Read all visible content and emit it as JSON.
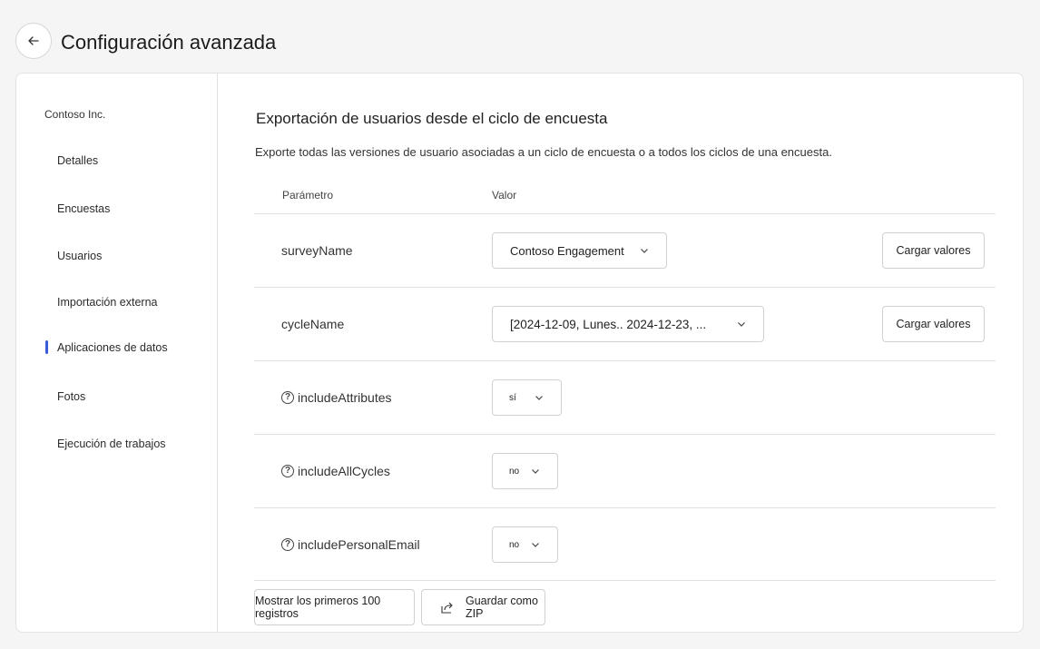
{
  "header": {
    "title": "Configuración avanzada"
  },
  "sidebar": {
    "org": "Contoso Inc.",
    "items": [
      {
        "label": "Detalles"
      },
      {
        "label": "Encuestas"
      },
      {
        "label": "Usuarios"
      },
      {
        "label": "Importación externa"
      },
      {
        "label": "Aplicaciones de datos",
        "active": true
      },
      {
        "label": "Fotos"
      },
      {
        "label": "Ejecución de trabajos"
      }
    ]
  },
  "main": {
    "title": "Exportación de usuarios desde el ciclo de encuesta",
    "description": "Exporte todas las versiones de usuario asociadas a un ciclo de encuesta o a todos los ciclos de una encuesta.",
    "col_param": "Parámetro",
    "col_value": "Valor",
    "rows": [
      {
        "param": "surveyName",
        "value": "Contoso Engagement",
        "button": "Cargar valores"
      },
      {
        "param": "cycleName",
        "value": "[2024-12-09, Lunes.. 2024-12-23, ...",
        "button": "Cargar valores"
      },
      {
        "param": "includeAttributes",
        "value": "sí"
      },
      {
        "param": "includeAllCycles",
        "value": "no"
      },
      {
        "param": "includePersonalEmail",
        "value": "no"
      }
    ],
    "show_button": "Mostrar los primeros 100 registros",
    "zip_button": "Guardar como ZIP"
  },
  "colors": {
    "accent": "#3b5bdb"
  },
  "icons": [
    "back-arrow-icon",
    "chevron-down-icon",
    "help-icon",
    "share-icon"
  ]
}
